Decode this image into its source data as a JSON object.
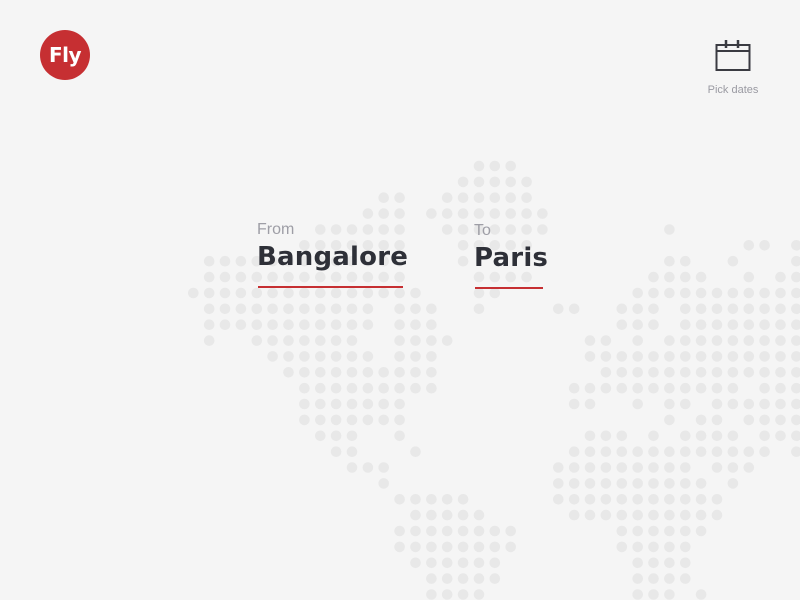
{
  "app": {
    "logo_text": "Fly",
    "brand_color": "#c62f32"
  },
  "header": {
    "pick_dates": {
      "icon": "calendar-icon",
      "label": "Pick dates"
    }
  },
  "search": {
    "from": {
      "label": "From",
      "value": "Bangalore"
    },
    "to": {
      "label": "To",
      "value": "Paris"
    }
  },
  "background": {
    "type": "dotted-world-map",
    "dot_color": "#e8e8e8",
    "rows": [
      [
        18,
        19,
        20
      ],
      [
        17,
        18,
        19,
        20,
        21
      ],
      [
        12,
        13,
        16,
        17,
        18,
        19,
        20,
        21
      ],
      [
        11,
        12,
        13,
        15,
        16,
        17,
        18,
        19,
        20,
        21,
        22
      ],
      [
        8,
        9,
        10,
        11,
        12,
        13,
        16,
        17,
        18,
        19,
        20,
        21,
        22,
        30
      ],
      [
        7,
        8,
        9,
        10,
        11,
        12,
        13,
        17,
        18,
        19,
        20,
        21,
        35,
        36,
        38
      ],
      [
        1,
        2,
        3,
        4,
        5,
        6,
        7,
        8,
        9,
        10,
        11,
        12,
        13,
        17,
        30,
        31,
        34,
        38
      ],
      [
        1,
        2,
        3,
        4,
        5,
        6,
        7,
        8,
        9,
        10,
        11,
        12,
        13,
        18,
        19,
        20,
        21,
        29,
        30,
        31,
        32,
        35,
        37,
        38
      ],
      [
        0,
        1,
        2,
        3,
        4,
        5,
        6,
        7,
        8,
        9,
        10,
        11,
        12,
        13,
        14,
        18,
        19,
        28,
        29,
        30,
        31,
        32,
        33,
        34,
        35,
        36,
        37,
        38
      ],
      [
        1,
        2,
        3,
        4,
        5,
        6,
        7,
        8,
        9,
        10,
        11,
        13,
        14,
        15,
        18,
        23,
        24,
        27,
        28,
        29,
        31,
        32,
        33,
        34,
        35,
        36,
        37,
        38
      ],
      [
        1,
        2,
        3,
        4,
        5,
        6,
        7,
        8,
        9,
        10,
        11,
        13,
        14,
        15,
        27,
        28,
        29,
        31,
        32,
        33,
        34,
        35,
        36,
        37,
        38
      ],
      [
        1,
        4,
        5,
        6,
        7,
        8,
        9,
        10,
        13,
        14,
        15,
        16,
        25,
        26,
        28,
        30,
        31,
        32,
        33,
        34,
        35,
        36,
        37,
        38
      ],
      [
        5,
        6,
        7,
        8,
        9,
        10,
        11,
        13,
        14,
        15,
        25,
        26,
        27,
        28,
        29,
        30,
        31,
        32,
        33,
        34,
        35,
        36,
        37,
        38
      ],
      [
        6,
        7,
        8,
        9,
        10,
        11,
        12,
        13,
        14,
        15,
        26,
        27,
        28,
        29,
        30,
        31,
        32,
        33,
        34,
        35,
        36,
        37,
        38
      ],
      [
        7,
        8,
        9,
        10,
        11,
        12,
        13,
        14,
        15,
        24,
        25,
        26,
        27,
        28,
        29,
        30,
        31,
        32,
        33,
        34,
        36,
        37,
        38
      ],
      [
        7,
        8,
        9,
        10,
        11,
        12,
        13,
        24,
        25,
        28,
        30,
        31,
        33,
        34,
        35,
        36,
        37,
        38
      ],
      [
        7,
        8,
        9,
        10,
        11,
        12,
        13,
        30,
        32,
        33,
        35,
        36,
        37,
        38
      ],
      [
        8,
        9,
        10,
        13,
        25,
        26,
        27,
        29,
        31,
        32,
        33,
        34,
        36,
        37,
        38
      ],
      [
        9,
        10,
        14,
        24,
        25,
        26,
        27,
        28,
        29,
        30,
        31,
        32,
        33,
        34,
        35,
        36,
        38
      ],
      [
        10,
        11,
        12,
        23,
        24,
        25,
        26,
        27,
        28,
        29,
        30,
        31,
        33,
        34,
        35
      ],
      [
        12,
        23,
        24,
        25,
        26,
        27,
        28,
        29,
        30,
        31,
        32,
        34
      ],
      [
        13,
        14,
        15,
        16,
        17,
        23,
        24,
        25,
        26,
        27,
        28,
        29,
        30,
        31,
        32,
        33
      ],
      [
        14,
        15,
        16,
        17,
        18,
        24,
        25,
        26,
        27,
        28,
        29,
        30,
        31,
        32,
        33
      ],
      [
        13,
        14,
        15,
        16,
        17,
        18,
        19,
        20,
        27,
        28,
        29,
        30,
        31,
        32
      ],
      [
        13,
        14,
        15,
        16,
        17,
        18,
        19,
        20,
        27,
        28,
        29,
        30,
        31
      ],
      [
        14,
        15,
        16,
        17,
        18,
        19,
        28,
        29,
        30,
        31
      ],
      [
        15,
        16,
        17,
        18,
        19,
        28,
        29,
        30,
        31
      ],
      [
        15,
        16,
        17,
        18,
        28,
        29,
        30,
        32
      ]
    ]
  }
}
